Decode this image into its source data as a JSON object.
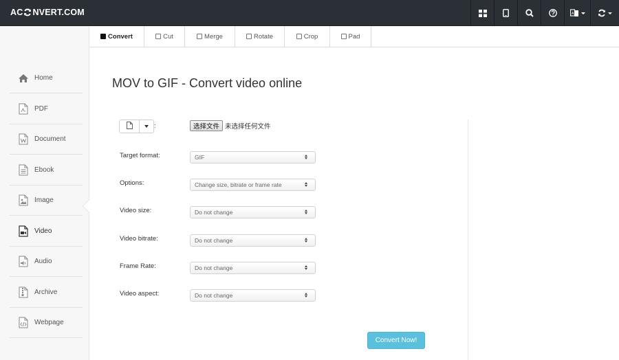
{
  "brand": {
    "prefix": "AC",
    "suffix": "NVERT.COM"
  },
  "navbar": {
    "icons": [
      "grid-icon",
      "tablet-icon",
      "search-icon",
      "help-icon",
      "language-icon",
      "refresh-icon"
    ]
  },
  "sidebar": {
    "items": [
      {
        "label": "Home",
        "icon": "home-icon"
      },
      {
        "label": "PDF",
        "icon": "pdf-file-icon"
      },
      {
        "label": "Document",
        "icon": "word-file-icon"
      },
      {
        "label": "Ebook",
        "icon": "ebook-file-icon"
      },
      {
        "label": "Image",
        "icon": "image-file-icon"
      },
      {
        "label": "Video",
        "icon": "video-file-icon",
        "active": true
      },
      {
        "label": "Audio",
        "icon": "audio-file-icon"
      },
      {
        "label": "Archive",
        "icon": "archive-file-icon"
      },
      {
        "label": "Webpage",
        "icon": "code-file-icon"
      }
    ]
  },
  "tabs": [
    {
      "label": "Convert",
      "active": true
    },
    {
      "label": "Cut"
    },
    {
      "label": "Merge"
    },
    {
      "label": "Rotate"
    },
    {
      "label": "Crop"
    },
    {
      "label": "Pad"
    }
  ],
  "main": {
    "title": "MOV to GIF - Convert video online",
    "file": {
      "colon": ":",
      "choose_label": "选择文件",
      "no_file_text": "未选择任何文件"
    },
    "form": [
      {
        "label": "Target format:",
        "value": "GIF"
      },
      {
        "label": "Options:",
        "value": "Change size, bitrate or frame rate"
      },
      {
        "label": "Video size:",
        "value": "Do not change"
      },
      {
        "label": "Video bitrate:",
        "value": "Do not change"
      },
      {
        "label": "Frame Rate:",
        "value": "Do not change"
      },
      {
        "label": "Video aspect:",
        "value": "Do not change"
      }
    ],
    "submit_label": "Convert Now!"
  },
  "colors": {
    "navbar_bg": "#2a3036",
    "sidebar_bg": "#f7f7f7",
    "button_info": "#5bc0de"
  }
}
